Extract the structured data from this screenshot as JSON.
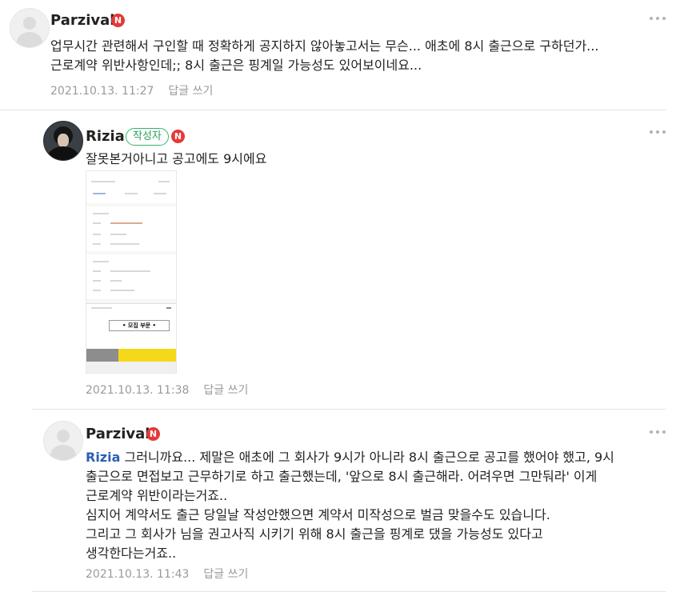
{
  "comments": [
    {
      "author": "Parzival",
      "new_badge": "N",
      "text": "업무시간 관련해서 구인할 때 정확하게 공지하지 않아놓고서는 무슨... 애초에 8시 출근으로 구하던가...\n근로계약 위반사항인데;; 8시 출근은 핑계일 가능성도 있어보이네요...",
      "date": "2021.10.13. 11:27",
      "reply_label": "답글 쓰기"
    },
    {
      "author": "Rizia",
      "author_badge": "작성자",
      "new_badge": "N",
      "text": "잘못본거아니고 공고에도 9시에요",
      "attachment": {
        "popup_title": "• 모집 부문 •"
      },
      "date": "2021.10.13. 11:38",
      "reply_label": "답글 쓰기"
    },
    {
      "author": "Parzival",
      "new_badge": "N",
      "mention": "Rizia",
      "text": " 그러니까요... 제말은 애초에 그 회사가 9시가 아니라 8시 출근으로 공고를 했어야 했고, 9시\n출근으로 면접보고 근무하기로 하고 출근했는데, '앞으로 8시 출근해라. 어려우면 그만둬라' 이게\n근로계약 위반이라는거죠..\n심지어 계약서도 출근 당일날 작성안했으면 계약서 미작성으로 벌금 맞을수도 있습니다.\n그리고 그 회사가 님을 권고사직 시키기 위해 8시 출근을 핑계로 댔을 가능성도 있다고\n생각한다는거죠..",
      "date": "2021.10.13. 11:43",
      "reply_label": "답글 쓰기"
    }
  ],
  "colors": {
    "new_badge": "#e53935",
    "author_badge": "#33b56b",
    "mention": "#2d5fb3",
    "meta": "#9a9a9a"
  },
  "icons": [
    "avatar-default",
    "avatar-photo",
    "more-options-icon"
  ]
}
